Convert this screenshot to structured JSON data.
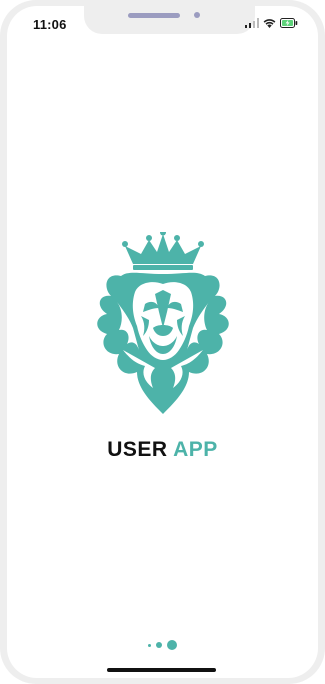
{
  "status_bar": {
    "time": "11:06",
    "icons": [
      "signal-icon",
      "wifi-icon",
      "battery-charging-icon"
    ]
  },
  "splash": {
    "logo_icon": "lion-crown-icon",
    "title_part1": "USER",
    "title_part2": "APP"
  },
  "pager": {
    "dots": 3
  },
  "colors": {
    "accent": "#4db3a9",
    "text": "#111111",
    "background": "#ffffff"
  }
}
